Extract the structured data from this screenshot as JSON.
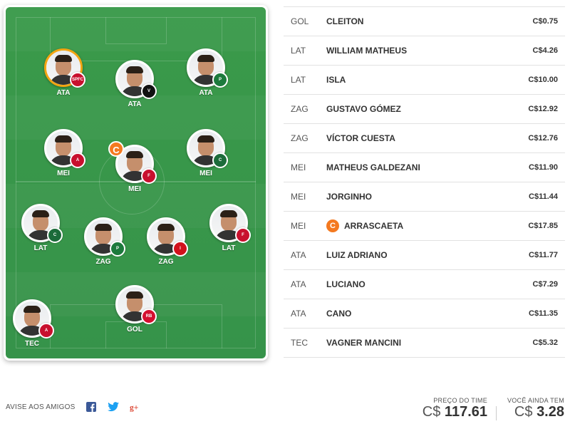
{
  "field": {
    "players": [
      {
        "pos": "ATA",
        "highlight": true,
        "captain": false,
        "crest": "#c8102e",
        "crest_text": "SPFC"
      },
      {
        "pos": "ATA",
        "highlight": false,
        "captain": false,
        "crest": "#111111",
        "crest_text": "V"
      },
      {
        "pos": "ATA",
        "highlight": false,
        "captain": false,
        "crest": "#1c7a3c",
        "crest_text": "P"
      },
      {
        "pos": "MEI",
        "highlight": false,
        "captain": false,
        "crest": "#c8102e",
        "crest_text": "A"
      },
      {
        "pos": "MEI",
        "highlight": false,
        "captain": true,
        "crest": "#c8102e",
        "crest_text": "F"
      },
      {
        "pos": "MEI",
        "highlight": false,
        "captain": false,
        "crest": "#1c6b3a",
        "crest_text": "C"
      },
      {
        "pos": "LAT",
        "highlight": false,
        "captain": false,
        "crest": "#1c6b3a",
        "crest_text": "C"
      },
      {
        "pos": "ZAG",
        "highlight": false,
        "captain": false,
        "crest": "#1c7a3c",
        "crest_text": "P"
      },
      {
        "pos": "ZAG",
        "highlight": false,
        "captain": false,
        "crest": "#d1111c",
        "crest_text": "I"
      },
      {
        "pos": "LAT",
        "highlight": false,
        "captain": false,
        "crest": "#c8102e",
        "crest_text": "F"
      },
      {
        "pos": "GOL",
        "highlight": false,
        "captain": false,
        "crest": "#d40f2f",
        "crest_text": "RB"
      },
      {
        "pos": "TEC",
        "highlight": false,
        "captain": false,
        "crest": "#c8102e",
        "crest_text": "A"
      }
    ],
    "captain_letter": "C"
  },
  "team": [
    {
      "pos": "GOL",
      "name": "CLEITON",
      "price": "C$0.75",
      "captain": false
    },
    {
      "pos": "LAT",
      "name": "WILLIAM MATHEUS",
      "price": "C$4.26",
      "captain": false
    },
    {
      "pos": "LAT",
      "name": "ISLA",
      "price": "C$10.00",
      "captain": false
    },
    {
      "pos": "ZAG",
      "name": "GUSTAVO GÓMEZ",
      "price": "C$12.92",
      "captain": false
    },
    {
      "pos": "ZAG",
      "name": "VÍCTOR CUESTA",
      "price": "C$12.76",
      "captain": false
    },
    {
      "pos": "MEI",
      "name": "MATHEUS GALDEZANI",
      "price": "C$11.90",
      "captain": false
    },
    {
      "pos": "MEI",
      "name": "JORGINHO",
      "price": "C$11.44",
      "captain": false
    },
    {
      "pos": "MEI",
      "name": "ARRASCAETA",
      "price": "C$17.85",
      "captain": true
    },
    {
      "pos": "ATA",
      "name": "LUIZ ADRIANO",
      "price": "C$11.77",
      "captain": false
    },
    {
      "pos": "ATA",
      "name": "LUCIANO",
      "price": "C$7.29",
      "captain": false
    },
    {
      "pos": "ATA",
      "name": "CANO",
      "price": "C$11.35",
      "captain": false
    },
    {
      "pos": "TEC",
      "name": "VAGNER MANCINI",
      "price": "C$5.32",
      "captain": false
    }
  ],
  "share": {
    "label": "AVISE AOS AMIGOS",
    "icons": [
      "facebook-icon",
      "twitter-icon",
      "google-plus-icon"
    ]
  },
  "summary": {
    "team_price_label": "PREÇO DO TIME",
    "currency": "C$",
    "team_price": "117.61",
    "remaining_label": "VOCÊ AINDA TEM",
    "remaining": "3.28"
  },
  "colors": {
    "field": "#3a9a4a",
    "captain": "#f47920",
    "highlight_ring": "#f3a512",
    "facebook": "#3b5998",
    "twitter": "#1da1f2",
    "google_plus": "#dd4b39"
  }
}
